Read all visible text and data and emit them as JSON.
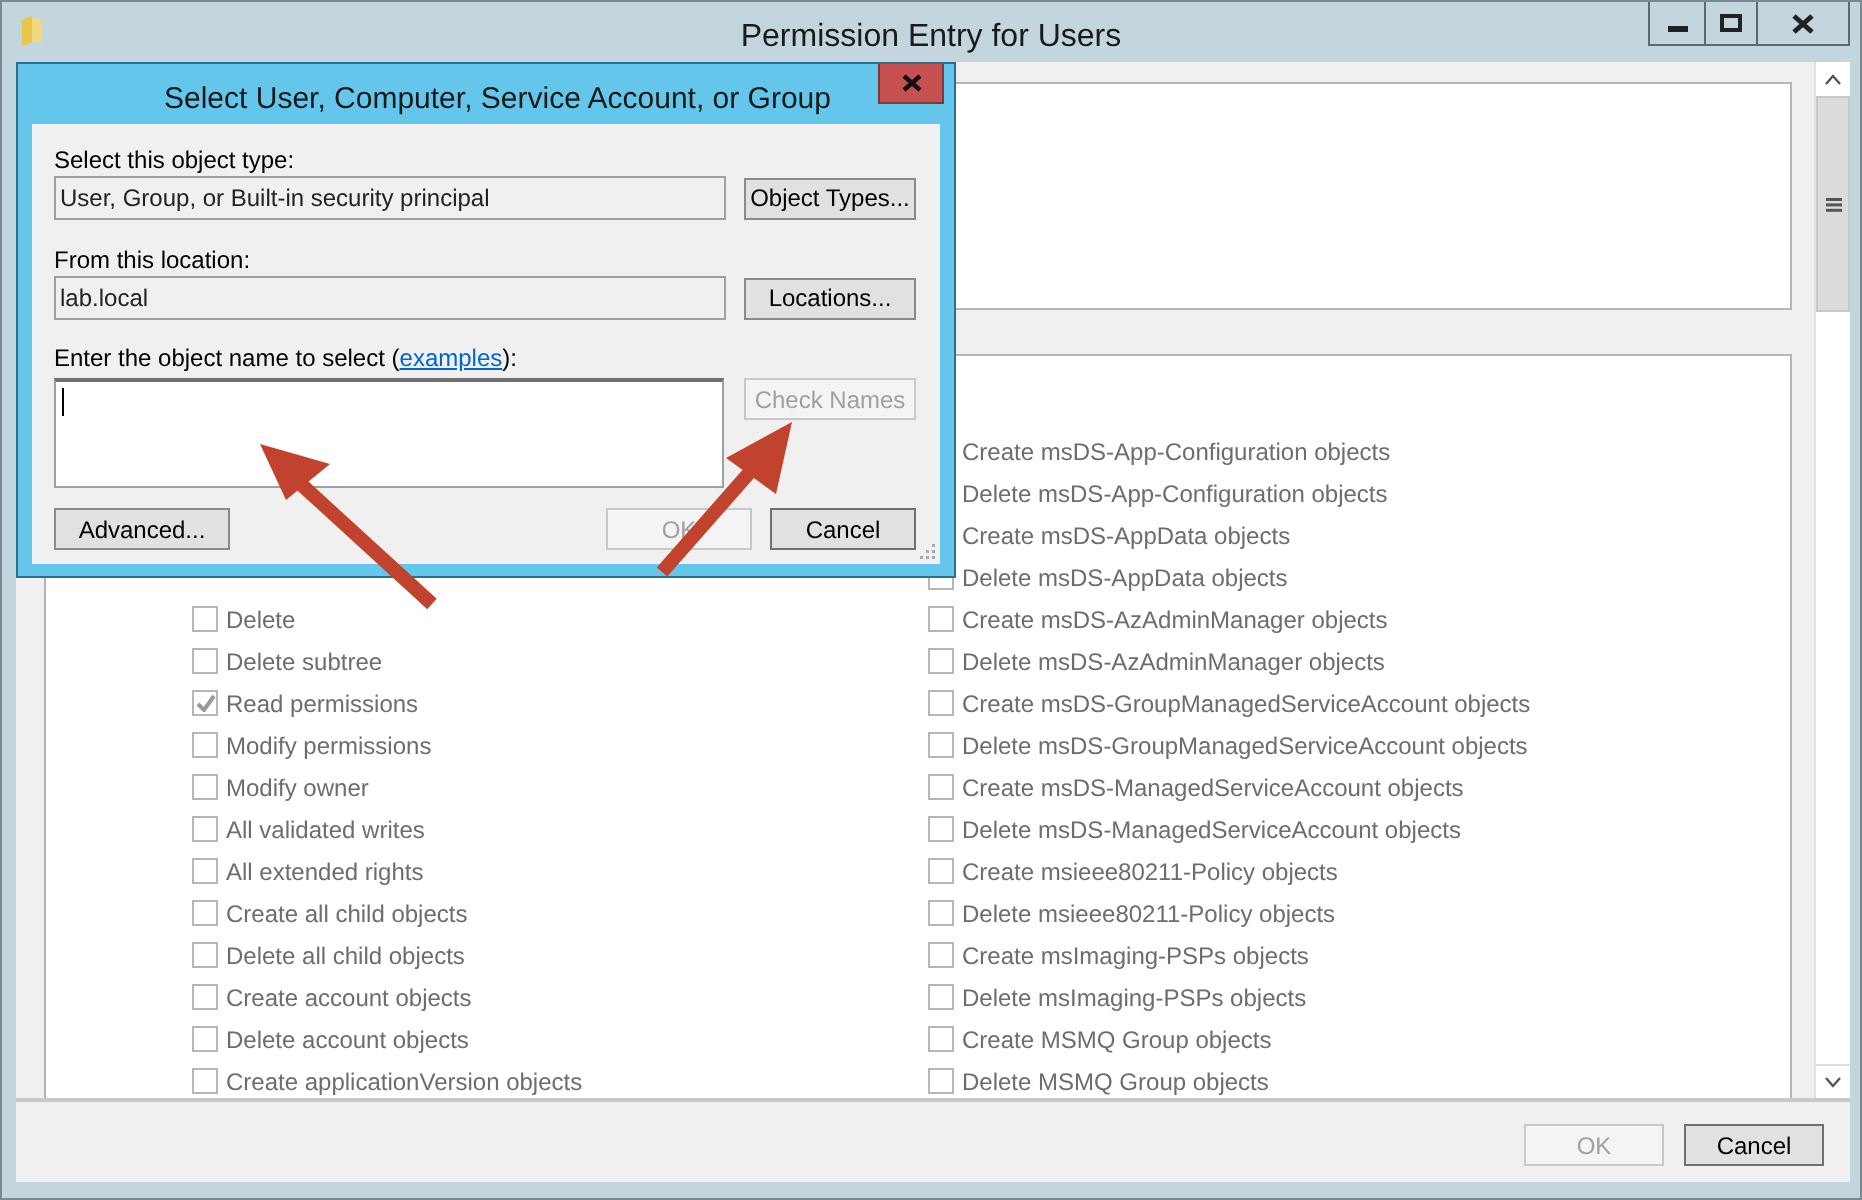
{
  "window": {
    "title": "Permission Entry for Users"
  },
  "permissions": {
    "left": [
      {
        "label": "Delete",
        "checked": false
      },
      {
        "label": "Delete subtree",
        "checked": false
      },
      {
        "label": "Read permissions",
        "checked": true
      },
      {
        "label": "Modify permissions",
        "checked": false
      },
      {
        "label": "Modify owner",
        "checked": false
      },
      {
        "label": "All validated writes",
        "checked": false
      },
      {
        "label": "All extended rights",
        "checked": false
      },
      {
        "label": "Create all child objects",
        "checked": false
      },
      {
        "label": "Delete all child objects",
        "checked": false
      },
      {
        "label": "Create account objects",
        "checked": false
      },
      {
        "label": "Delete account objects",
        "checked": false
      },
      {
        "label": "Create applicationVersion objects",
        "checked": false
      }
    ],
    "right": [
      {
        "label": "Create msDS-App-Configuration objects"
      },
      {
        "label": "Delete msDS-App-Configuration objects"
      },
      {
        "label": "Create msDS-AppData objects"
      },
      {
        "label": "Delete msDS-AppData objects"
      },
      {
        "label": "Create msDS-AzAdminManager objects",
        "checked": false
      },
      {
        "label": "Delete msDS-AzAdminManager objects",
        "checked": false
      },
      {
        "label": "Create msDS-GroupManagedServiceAccount objects",
        "checked": false
      },
      {
        "label": "Delete msDS-GroupManagedServiceAccount objects",
        "checked": false
      },
      {
        "label": "Create msDS-ManagedServiceAccount objects",
        "checked": false
      },
      {
        "label": "Delete msDS-ManagedServiceAccount objects",
        "checked": false
      },
      {
        "label": "Create msieee80211-Policy objects",
        "checked": false
      },
      {
        "label": "Delete msieee80211-Policy objects",
        "checked": false
      },
      {
        "label": "Create msImaging-PSPs objects",
        "checked": false
      },
      {
        "label": "Delete msImaging-PSPs objects",
        "checked": false
      },
      {
        "label": "Create MSMQ Group objects",
        "checked": false
      },
      {
        "label": "Delete MSMQ Group objects",
        "checked": false
      }
    ]
  },
  "footer_buttons": [
    {
      "label": "OK",
      "disabled": true
    },
    {
      "label": "Cancel",
      "disabled": false
    }
  ],
  "dialog": {
    "title": "Select User, Computer, Service Account, or Group",
    "object_type_label": "Select this object type:",
    "object_type_value": "User, Group, or Built-in security principal",
    "object_types_button": "Object Types...",
    "location_label": "From this location:",
    "location_value": "lab.local",
    "locations_button": "Locations...",
    "name_label_before": "Enter the object name to select (",
    "examples_link": "examples",
    "name_label_after": "):",
    "check_names_button": {
      "label": "Check Names",
      "disabled": true
    },
    "advanced_button": "Advanced...",
    "buttons": [
      {
        "label": "OK",
        "disabled": true
      },
      {
        "label": "Cancel",
        "disabled": false
      }
    ]
  }
}
